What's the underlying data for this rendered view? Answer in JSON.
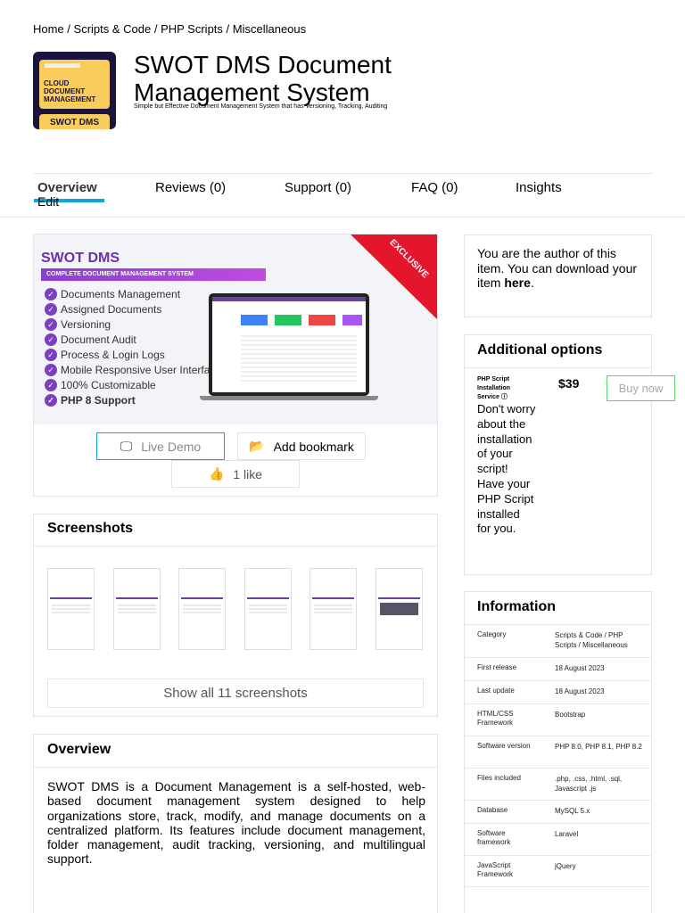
{
  "breadcrumb": [
    "Home",
    "Scripts & Code",
    "PHP Scripts",
    "Miscellaneous"
  ],
  "logo": {
    "line1": "CLOUD",
    "line2": "DOCUMENT",
    "line3": "MANAGEMENT",
    "badge": "SWOT DMS"
  },
  "item": {
    "title": "SWOT DMS Document Management System",
    "subtitle": "Simple but Effective Document Management System that has Versioning, Tracking, Auditing"
  },
  "tabs": [
    "Overview",
    "Reviews (0)",
    "Support (0)",
    "FAQ (0)",
    "Insights"
  ],
  "edit_label": "Edit",
  "preview": {
    "brand": "SWOT DMS",
    "tagline": "COMPLETE DOCUMENT MANAGEMENT SYSTEM",
    "ribbon": "EXCLUSIVE",
    "features": [
      "Documents Management",
      "Assigned Documents",
      "Versioning",
      "Document Audit",
      "Process & Login Logs",
      "Mobile Responsive User Interface",
      "100% Customizable",
      "PHP 8 Support"
    ]
  },
  "actions": {
    "live_demo": "Live Demo",
    "bookmark": "Add bookmark",
    "likes": "1 like"
  },
  "screenshots": {
    "heading": "Screenshots",
    "count": 6,
    "show_all": "Show all 11 screenshots"
  },
  "overview": {
    "heading": "Overview",
    "text": "SWOT DMS is a Document Management is a self-hosted, web-based document management system designed to help organizations store, track, modify, and manage documents on a centralized platform. Its features include document management, folder management, audit tracking, versioning, and multilingual support."
  },
  "author": {
    "text": "You are the author of this item. You can download your item ",
    "link": "here",
    "end": "."
  },
  "options": {
    "heading": "Additional options",
    "service": "PHP Script Installation Service",
    "price": "$39",
    "buy": "Buy now",
    "desc": "Don't worry about the installation of your script! Have your PHP Script installed for you."
  },
  "information": {
    "heading": "Information",
    "rows": [
      {
        "k": "Category",
        "v": "Scripts & Code / PHP Scripts / Miscellaneous"
      },
      {
        "k": "First release",
        "v": "18 August 2023"
      },
      {
        "k": "Last update",
        "v": "18 August 2023"
      },
      {
        "k": "HTML/CSS Framework",
        "v": "Bootstrap"
      },
      {
        "k": "Software version",
        "v": "PHP 8.0, PHP 8.1, PHP 8.2"
      },
      {
        "k": "Files included",
        "v": ".php, .css, .html, .sql, Javascript .js"
      },
      {
        "k": "Database",
        "v": "MySQL 5.x"
      },
      {
        "k": "Software framework",
        "v": "Laravel"
      },
      {
        "k": "JavaScript Framework",
        "v": "jQuery"
      }
    ]
  },
  "colors": {
    "accent": "#0ea5d9",
    "purple": "#7b3fbf",
    "buy_border": "#5fd36f",
    "ribbon": "#e3162e"
  }
}
